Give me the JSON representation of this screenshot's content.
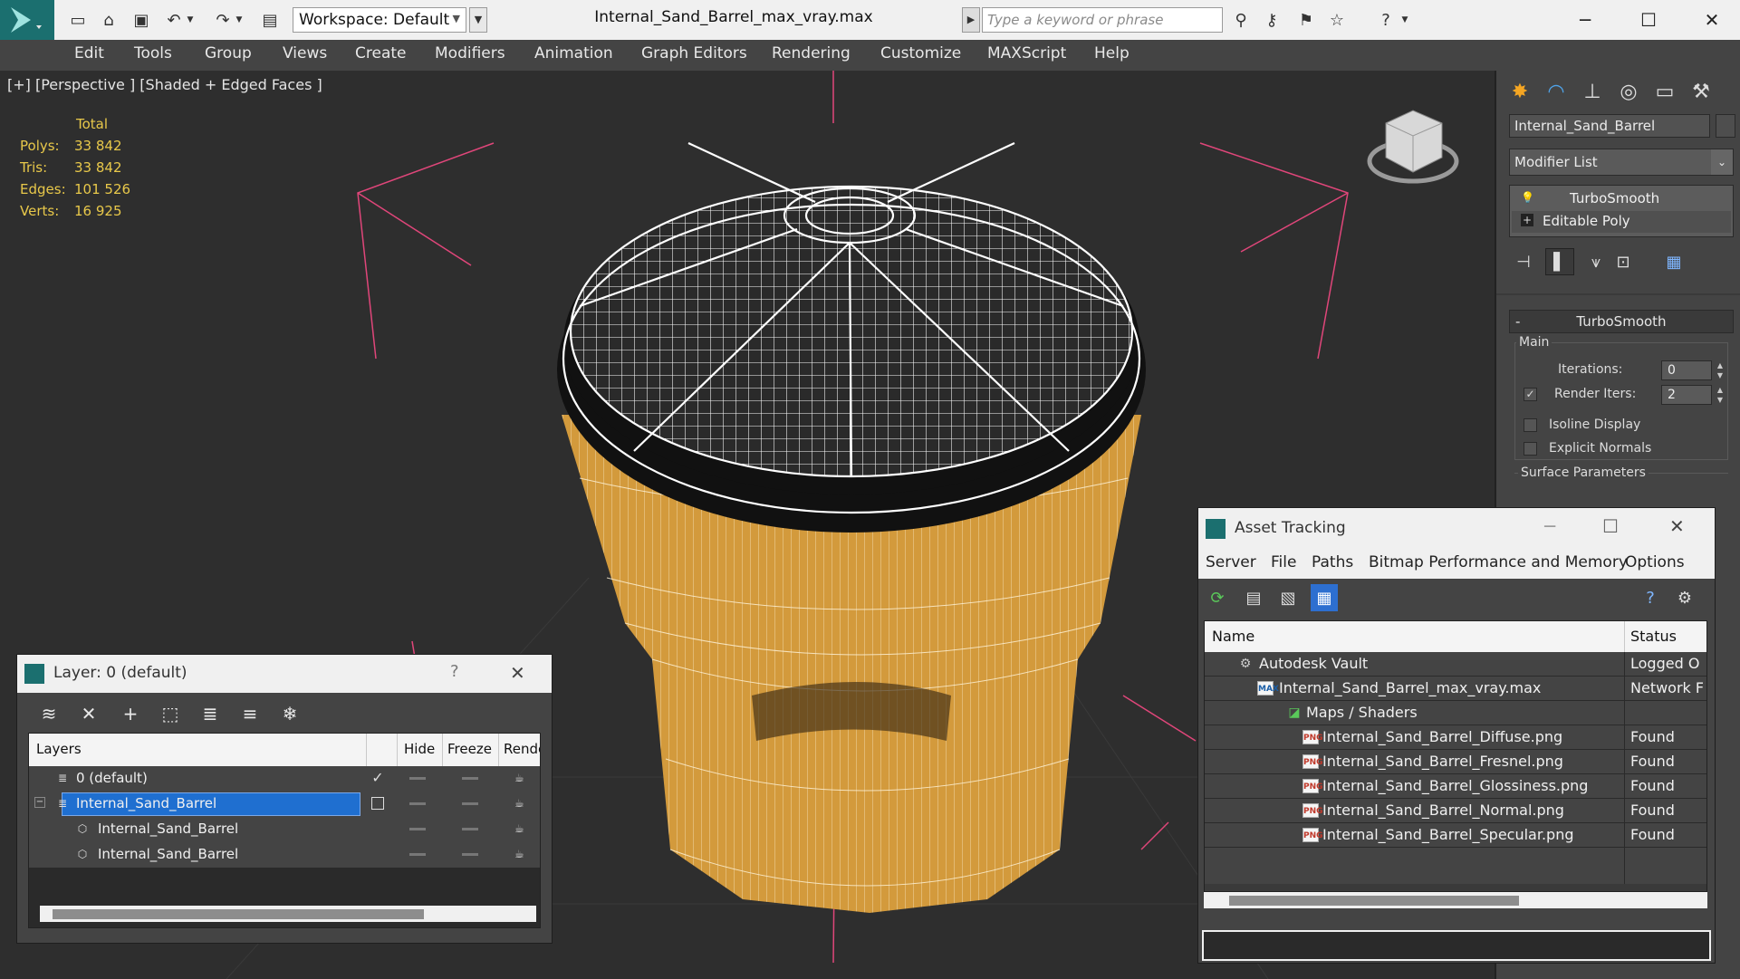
{
  "app": {
    "title": "Internal_Sand_Barrel_max_vray.max",
    "workspace": "Workspace: Default",
    "search_placeholder": "Type a keyword or phrase",
    "accent": "#1b6f6f"
  },
  "menu": [
    "Edit",
    "Tools",
    "Group",
    "Views",
    "Create",
    "Modifiers",
    "Animation",
    "Graph Editors",
    "Rendering",
    "Customize",
    "MAXScript",
    "Help"
  ],
  "viewport": {
    "label": "[+] [Perspective ] [Shaded + Edged Faces ]",
    "stats": {
      "header": "Total",
      "rows": [
        {
          "k": "Polys:",
          "v": "33 842"
        },
        {
          "k": "Tris:",
          "v": "33 842"
        },
        {
          "k": "Edges:",
          "v": "101 526"
        },
        {
          "k": "Verts:",
          "v": "16 925"
        }
      ]
    },
    "object_color": "#d39a3c",
    "wire_color": "#ffffff",
    "guide_color": "#e0467a"
  },
  "command_panel": {
    "object_name": "Internal_Sand_Barrel",
    "modifier_list": "Modifier List",
    "stack": [
      "TurboSmooth",
      "Editable Poly"
    ],
    "rollout": "TurboSmooth",
    "main_label": "Main",
    "iterations_label": "Iterations:",
    "iterations_value": "0",
    "render_iters_label": "Render Iters:",
    "render_iters_value": "2",
    "isoline_label": "Isoline Display",
    "explicit_normals_label": "Explicit Normals",
    "surface_params_label": "Surface Parameters"
  },
  "layer_dialog": {
    "title": "Layer: 0 (default)",
    "help": "?",
    "columns": [
      "Layers",
      "Hide",
      "Freeze",
      "Render"
    ],
    "rows": [
      {
        "name": "0 (default)"
      },
      {
        "name": "Internal_Sand_Barrel"
      },
      {
        "name": "Internal_Sand_Barrel"
      },
      {
        "name": "Internal_Sand_Barrel"
      }
    ]
  },
  "asset_dialog": {
    "title": "Asset Tracking",
    "menu": [
      "Server",
      "File",
      "Paths",
      "Bitmap Performance and Memory",
      "Options"
    ],
    "columns": [
      "Name",
      "Status"
    ],
    "rows": [
      {
        "name": "Autodesk Vault",
        "status": "Logged O"
      },
      {
        "name": "Internal_Sand_Barrel_max_vray.max",
        "status": "Network F"
      },
      {
        "name": "Maps / Shaders",
        "status": ""
      },
      {
        "name": "Internal_Sand_Barrel_Diffuse.png",
        "status": "Found"
      },
      {
        "name": "Internal_Sand_Barrel_Fresnel.png",
        "status": "Found"
      },
      {
        "name": "Internal_Sand_Barrel_Glossiness.png",
        "status": "Found"
      },
      {
        "name": "Internal_Sand_Barrel_Normal.png",
        "status": "Found"
      },
      {
        "name": "Internal_Sand_Barrel_Specular.png",
        "status": "Found"
      }
    ],
    "png_icon_text": "PNG",
    "max_icon_text": "MAX"
  }
}
